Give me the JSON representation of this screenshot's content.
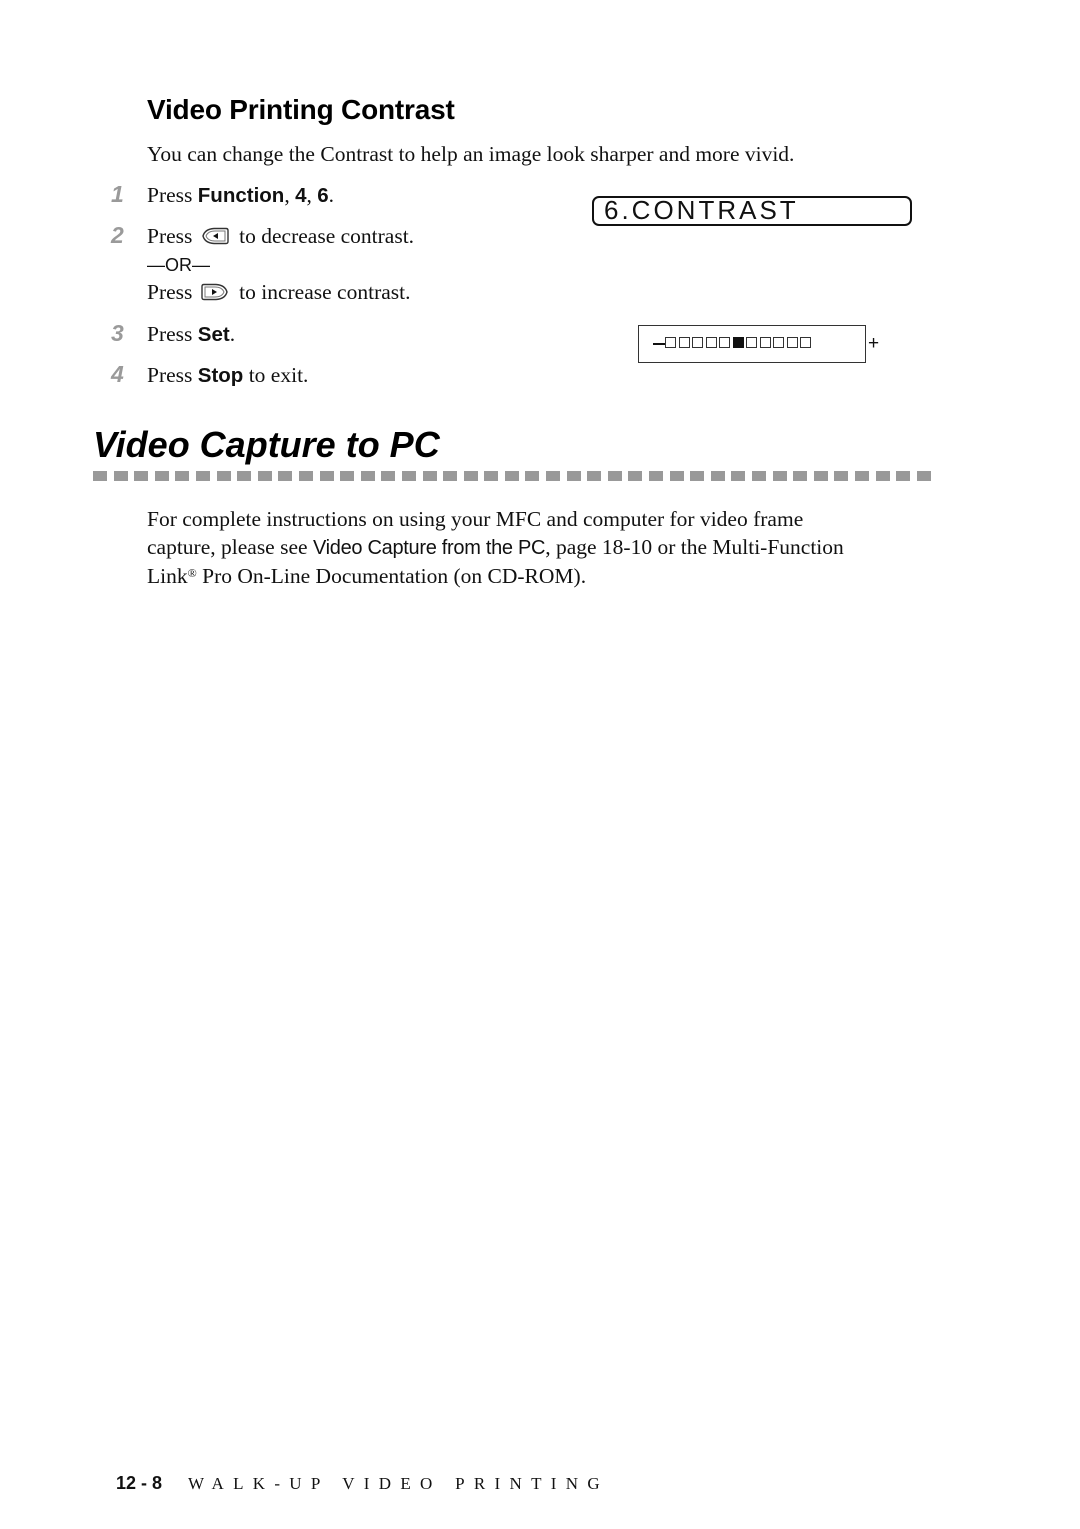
{
  "section": {
    "heading": "Video Printing Contrast",
    "intro": "You can change the Contrast to help an image look sharper and more vivid.",
    "steps": [
      {
        "num": "1",
        "prefix": "Press ",
        "bold": "Function",
        "suffix": ", ",
        "bold2": "4",
        "mid": ", ",
        "bold3": "6",
        "end": "."
      },
      {
        "num": "2",
        "prefix": "Press ",
        "icon": "left-arrow-key-icon",
        "suffix": " to decrease contrast."
      },
      {
        "or_text": "—OR—"
      },
      {
        "prefix": "Press ",
        "icon": "right-arrow-key-icon",
        "suffix": " to increase contrast."
      },
      {
        "num": "3",
        "prefix": "Press ",
        "bold": "Set",
        "suffix": "."
      },
      {
        "num": "4",
        "prefix": "Press ",
        "bold": "Stop",
        "suffix": " to exit."
      }
    ],
    "lcd_menu": "6.CONTRAST",
    "lcd_scale": {
      "minus": "−",
      "plus": "+",
      "levels": 11,
      "current_level": 6
    }
  },
  "capture": {
    "heading": "Video Capture to PC",
    "para_line1": "For complete instructions on using your MFC and computer for video frame",
    "para_line2_a": "capture, please see ",
    "para_line2_ref": "Video Capture from the PC",
    "para_line2_b": ", page 18-10 or the Multi-Function",
    "para_line3_a": "Link",
    "para_line3_reg": "®",
    "para_line3_b": " Pro On-Line Documentation (on CD-ROM)."
  },
  "footer": {
    "page": "12 - 8",
    "chapter": "WALK-UP VIDEO PRINTING"
  }
}
